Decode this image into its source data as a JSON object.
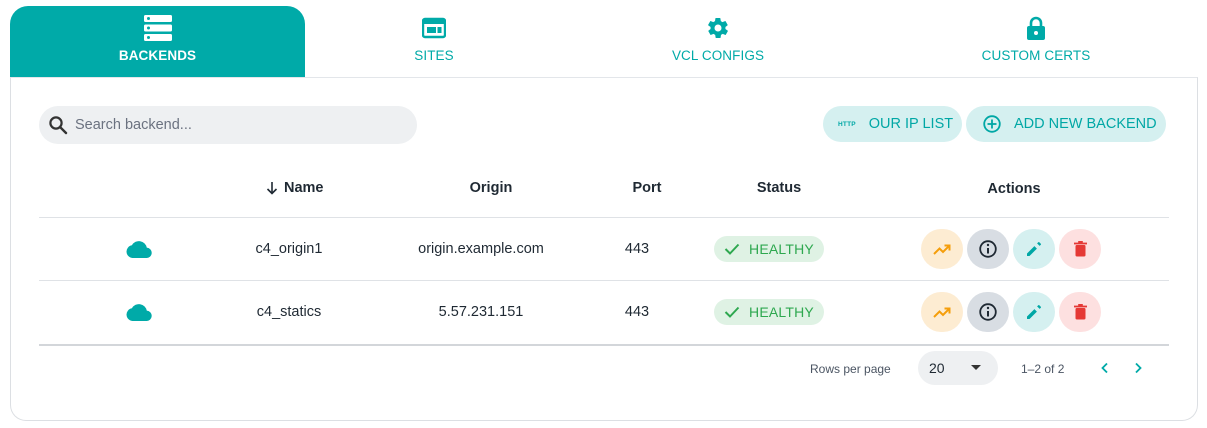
{
  "tabs": [
    {
      "label": "BACKENDS",
      "icon": "server-icon",
      "active": true
    },
    {
      "label": "SITES",
      "icon": "window-icon",
      "active": false
    },
    {
      "label": "VCL CONFIGS",
      "icon": "gear-icon",
      "active": false
    },
    {
      "label": "CUSTOM CERTS",
      "icon": "lock-icon",
      "active": false
    }
  ],
  "search": {
    "placeholder": "Search backend..."
  },
  "buttons": {
    "ip_list": {
      "tag": "HTTP",
      "label": "OUR IP LIST"
    },
    "add_backend": {
      "label": "ADD NEW BACKEND"
    }
  },
  "table": {
    "columns": [
      "Name",
      "Origin",
      "Port",
      "Status",
      "Actions"
    ],
    "sort": {
      "column": "Name",
      "direction": "descending-arrow"
    },
    "rows": [
      {
        "icon": "cloud-icon",
        "name": "c4_origin1",
        "origin": "origin.example.com",
        "port": "443",
        "status": "HEALTHY"
      },
      {
        "icon": "cloud-icon",
        "name": "c4_statics",
        "origin": "5.57.231.151",
        "port": "443",
        "status": "HEALTHY"
      }
    ],
    "actions": [
      "trending-up-icon",
      "info-icon",
      "pencil-icon",
      "trash-icon"
    ]
  },
  "pagination": {
    "rows_per_page_label": "Rows per page",
    "rows_per_page": "20",
    "range": "1–2 of 2"
  },
  "colors": {
    "accent": "#00aaa8",
    "healthy": "#2ea84f",
    "trend": "#f59e0b",
    "delete": "#e53935"
  }
}
